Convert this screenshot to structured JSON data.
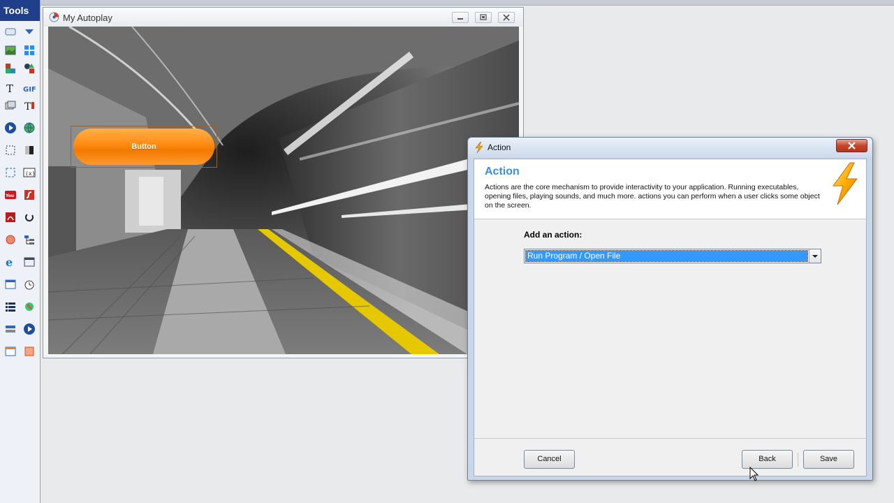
{
  "tools": {
    "header": "Tools",
    "icons": [
      [
        "rectangle-icon",
        "dropdown-triangle-icon"
      ],
      [
        "image-icon",
        "windows-logo-icon"
      ],
      [
        "colored-shapes-icon",
        "shapes-icon"
      ],
      [
        "text-icon",
        "gif-icon"
      ],
      [
        "slideshow-icon",
        "paragraph-text-icon"
      ],
      [
        "media-player-icon",
        "web-globe-icon"
      ],
      [
        "selection-icon",
        "gradient-icon"
      ],
      [
        "hotspot-icon",
        "variable-icon"
      ],
      [
        "youtube-icon",
        "flash-icon"
      ],
      [
        "pdf-icon",
        "spinner-icon"
      ],
      [
        "circle-icon",
        "tree-icon"
      ],
      [
        "internet-explorer-icon",
        "panel-icon"
      ],
      [
        "window-icon",
        "timer-icon"
      ],
      [
        "list-icon",
        "plugin-icon"
      ],
      [
        "progress-icon",
        "play-icon"
      ],
      [
        "edit-window-icon",
        "square-icon"
      ]
    ]
  },
  "autoplay_window": {
    "title": "My Autoplay",
    "button_label": "Button"
  },
  "action_dialog": {
    "title": "Action",
    "heading": "Action",
    "description": "Actions are the core mechanism to provide interactivity to your application. Running executables, opening files, playing sounds, and much more. actions you can perform when a user clicks some object on the screen.",
    "add_action_label": "Add an action:",
    "selected_action": "Run Program / Open File",
    "buttons": {
      "cancel": "Cancel",
      "back": "Back",
      "save": "Save"
    }
  },
  "colors": {
    "tools_header": "#1f3f8a",
    "accent_heading": "#3a8fd6",
    "selection": "#3399ff",
    "orange_button": "#ff8a10"
  }
}
